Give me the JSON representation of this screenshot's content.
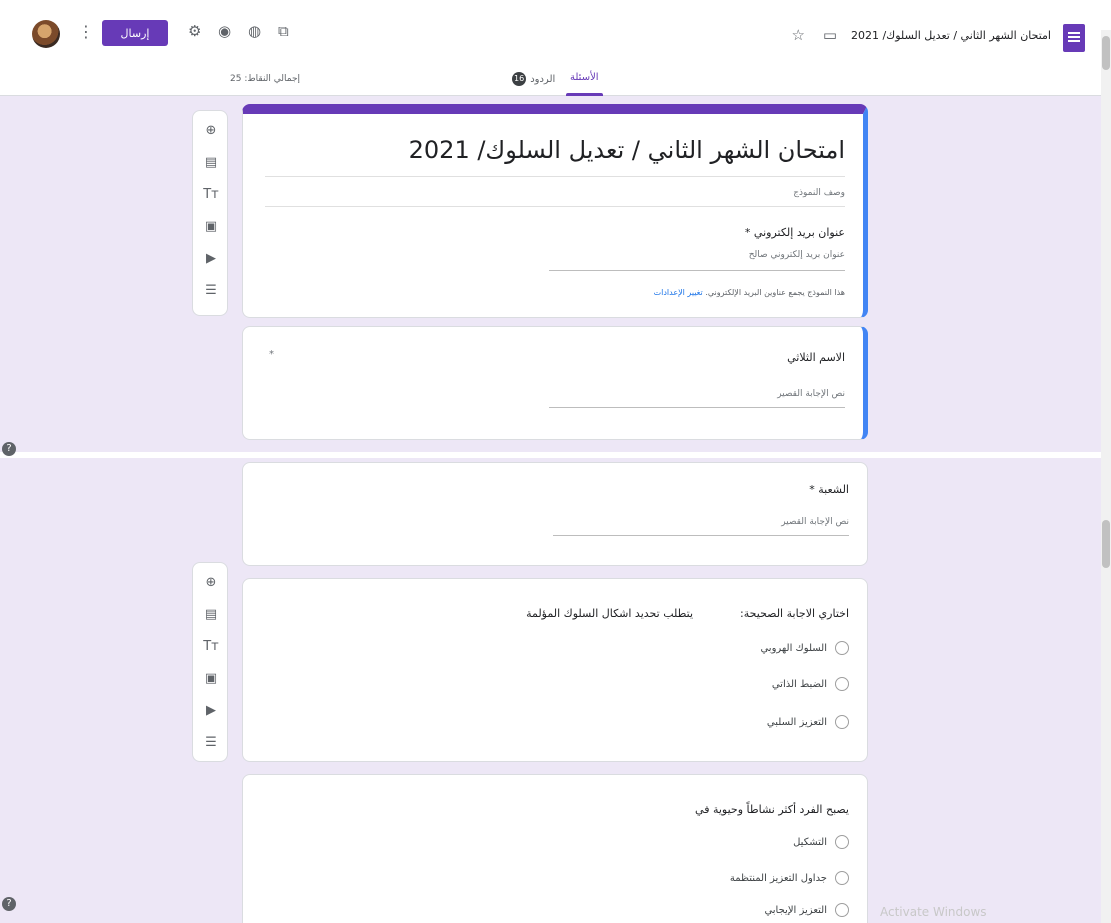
{
  "header": {
    "doc_title": "امتحان الشهر الثاني / تعديل السلوك/ 2021",
    "send_label": "إرسال",
    "icons": {
      "settings": "gear-icon",
      "preview": "eye-icon",
      "palette": "palette-icon",
      "addons": "puzzle-icon",
      "more": "more-vert-icon",
      "star": "star-icon",
      "folder": "folder-icon"
    }
  },
  "tabs": {
    "questions": "الأسئلة",
    "responses": "الردود",
    "responses_count": "16",
    "total_points": "إجمالي النقاط: 25"
  },
  "form": {
    "title": "امتحان الشهر الثاني / تعديل السلوك/ 2021",
    "description_placeholder": "وصف النموذج",
    "email": {
      "label": "عنوان بريد إلكتروني *",
      "placeholder": "عنوان بريد إلكتروني صالح",
      "note": "هذا النموذج يجمع عناوين البريد الإلكتروني.",
      "note_link": "تغيير الإعدادات"
    }
  },
  "questions": [
    {
      "title": "الاسم الثلاثي",
      "placeholder": "نص الإجابة القصير",
      "required_mark": "*"
    },
    {
      "title": "الشعبة *",
      "placeholder": "نص الإجابة القصير"
    },
    {
      "title": "اختاري الاجابة الصحيحة:",
      "subtitle": "يتطلب تحديد اشكال السلوك المؤلمة",
      "options": [
        "السلوك الهروبي",
        "الضبط الذاتي",
        "التعزيز السلبي"
      ]
    },
    {
      "title": "يصبح الفرد أكثر نشاطاً وحيوية في",
      "options": [
        "التشكيل",
        "جداول التعزيز المنتظمة",
        "التعزيز الإيجابي"
      ]
    }
  ],
  "toolbar": {
    "items": [
      "add-question-icon",
      "import-questions-icon",
      "add-title-icon",
      "add-image-icon",
      "add-video-icon",
      "add-section-icon"
    ]
  },
  "system": {
    "watermark": "Activate Windows"
  },
  "colors": {
    "accent": "#673ab7",
    "focus": "#4285f4",
    "background": "#ede7f6"
  }
}
